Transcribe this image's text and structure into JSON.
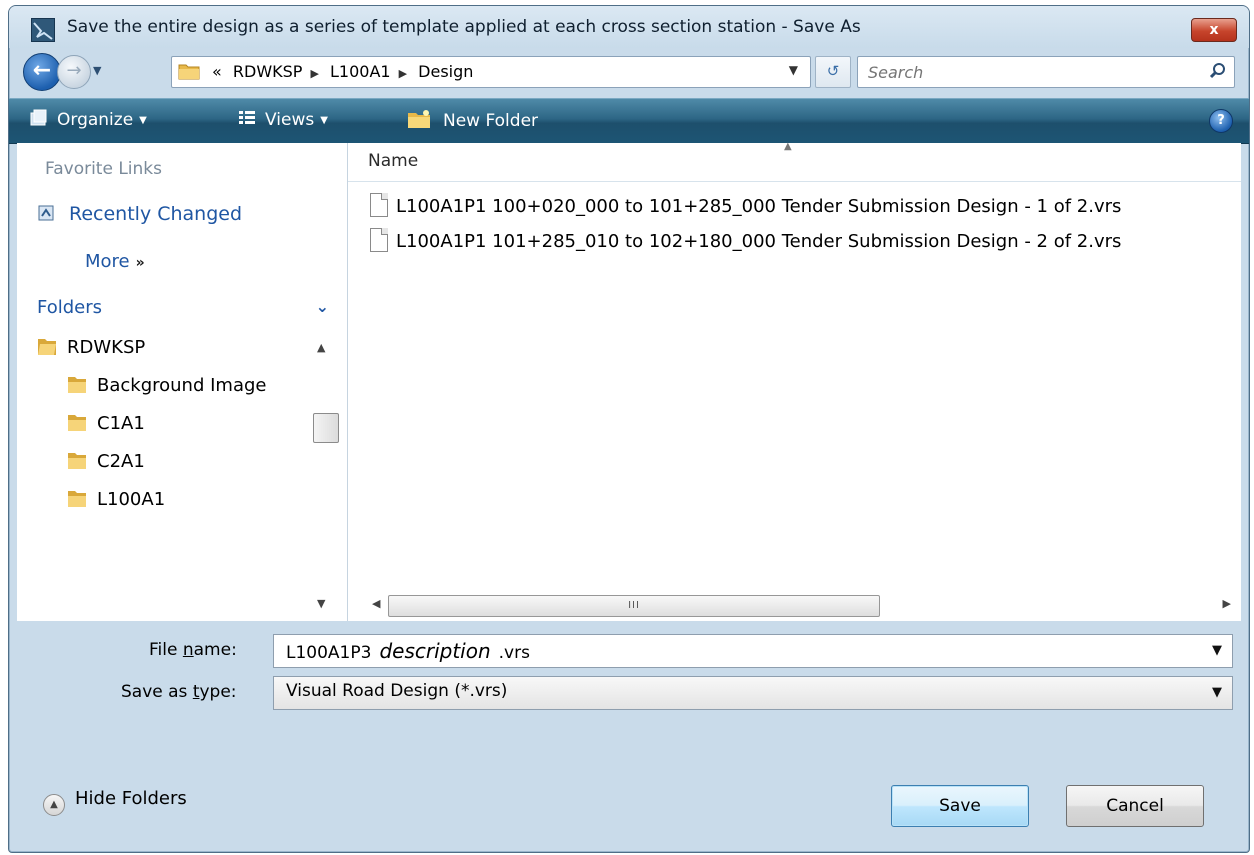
{
  "window": {
    "title": "Save the entire design as a series of template applied at each cross section station - Save As",
    "close_label": "x"
  },
  "address": {
    "overflow": "«",
    "crumbs": [
      "RDWKSP",
      "L100A1",
      "Design"
    ],
    "search_placeholder": "Search"
  },
  "toolbar": {
    "organize": "Organize",
    "views": "Views",
    "new_folder": "New Folder",
    "help": "?"
  },
  "nav": {
    "favorite_links_title": "Favorite Links",
    "recently_changed": "Recently Changed",
    "more": "More",
    "more_glyph": "»",
    "folders_title": "Folders",
    "tree": {
      "root": "RDWKSP",
      "children": [
        "Background Image",
        "C1A1",
        "C2A1",
        "L100A1"
      ]
    }
  },
  "file_list": {
    "column_name": "Name",
    "files": [
      "L100A1P1 100+020_000 to 101+285_000 Tender Submission Design - 1 of 2.vrs",
      "L100A1P1 101+285_010 to 102+180_000 Tender Submission Design - 2 of 2.vrs"
    ],
    "hscroll_grip": "III"
  },
  "form": {
    "file_name_label_pre": "File ",
    "file_name_label_key": "n",
    "file_name_label_post": "ame:",
    "file_name_value_prefix": "L100A1P3",
    "file_name_value_desc": "description",
    "file_name_value_suffix": ".vrs",
    "save_type_label_pre": "Save as ",
    "save_type_label_key": "t",
    "save_type_label_post": "ype:",
    "save_type_value": "Visual Road Design (*.vrs)"
  },
  "footer": {
    "hide_folders": "Hide Folders",
    "save": "Save",
    "cancel": "Cancel"
  },
  "colors": {
    "toolbar": "#2d6685",
    "link": "#1f56a3",
    "chrome": "#c9dbea"
  }
}
